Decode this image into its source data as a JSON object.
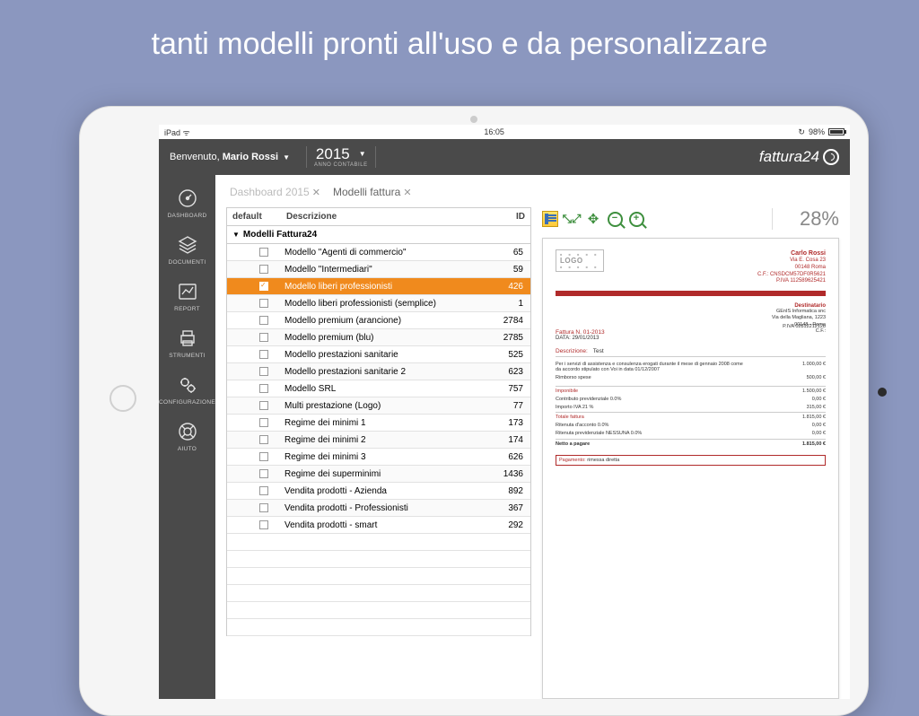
{
  "banner": "tanti modelli pronti all'uso e da personalizzare",
  "status": {
    "device": "iPad",
    "time": "16:05",
    "battery": "98%"
  },
  "header": {
    "welcome_prefix": "Benvenuto, ",
    "user_name": "Mario Rossi",
    "year": "2015",
    "year_sub": "ANNO CONTABILE",
    "brand": "fattura24"
  },
  "sidebar": [
    {
      "key": "dashboard",
      "label": "DASHBOARD"
    },
    {
      "key": "documenti",
      "label": "DOCUMENTI"
    },
    {
      "key": "report",
      "label": "REPORT"
    },
    {
      "key": "strumenti",
      "label": "STRUMENTI"
    },
    {
      "key": "config",
      "label": "CONFIGURAZIONE"
    },
    {
      "key": "aiuto",
      "label": "AIUTO"
    }
  ],
  "crumbs": {
    "dashboard": "Dashboard 2015",
    "modelli": "Modelli fattura"
  },
  "table": {
    "col_default": "default",
    "col_desc": "Descrizione",
    "col_id": "ID",
    "group": "Modelli Fattura24",
    "rows": [
      {
        "desc": "Modello \"Agenti di commercio\"",
        "id": 65,
        "checked": false
      },
      {
        "desc": "Modello \"Intermediari\"",
        "id": 59,
        "checked": false
      },
      {
        "desc": "Modello liberi professionisti",
        "id": 426,
        "checked": true
      },
      {
        "desc": "Modello liberi professionisti (semplice)",
        "id": 1,
        "checked": false
      },
      {
        "desc": "Modello premium (arancione)",
        "id": 2784,
        "checked": false
      },
      {
        "desc": "Modello premium (blu)",
        "id": 2785,
        "checked": false
      },
      {
        "desc": "Modello prestazioni sanitarie",
        "id": 525,
        "checked": false
      },
      {
        "desc": "Modello prestazioni sanitarie 2",
        "id": 623,
        "checked": false
      },
      {
        "desc": "Modello SRL",
        "id": 757,
        "checked": false
      },
      {
        "desc": "Multi prestazione (Logo)",
        "id": 77,
        "checked": false
      },
      {
        "desc": "Regime dei minimi 1",
        "id": 173,
        "checked": false
      },
      {
        "desc": "Regime dei minimi 2",
        "id": 174,
        "checked": false
      },
      {
        "desc": "Regime dei minimi 3",
        "id": 626,
        "checked": false
      },
      {
        "desc": "Regime dei superminimi",
        "id": 1436,
        "checked": false
      },
      {
        "desc": "Vendita prodotti - Azienda",
        "id": 892,
        "checked": false
      },
      {
        "desc": "Vendita prodotti - Professionisti",
        "id": 367,
        "checked": false
      },
      {
        "desc": "Vendita prodotti - smart",
        "id": 292,
        "checked": false
      }
    ]
  },
  "toolbar": {
    "zoom_pct": "28%"
  },
  "preview": {
    "logo": "LOGO",
    "sender": {
      "name": "Carlo Rossi",
      "addr1": "Via E. Cosa 23",
      "addr2": "00148 Roma",
      "cf": "C.F.: CNSDCM57DF0R5621",
      "piva": "P.IVA 112589625421"
    },
    "dest_label": "Destinatario",
    "dest": {
      "name": "GEnIS Informatica snc",
      "addr": "Via della Magliana, 1223",
      "city": "00148 - Roma",
      "cf": "C.F.:",
      "piva": "P.IVA 02812212128"
    },
    "doc_no_label": "Fattura N.",
    "doc_no": "01-2013",
    "date_label": "DATA:",
    "date": "29/01/2013",
    "desc_label": "Descrizione:",
    "desc_val": "Test",
    "lines": [
      {
        "label": "Per i servizi di assistenza e consulenza erogati durante il mese di gennaio 2008 come da accordo stipulato con Voi in data 01/12/2007",
        "value": "1.000,00 €"
      },
      {
        "label": "Rimborso spese",
        "value": "500,00 €"
      }
    ],
    "totals": [
      {
        "label": "Imponibile",
        "value": "1.500,00 €",
        "red": true,
        "br": true
      },
      {
        "label": "Contributo previdenziale  0.0%",
        "value": "0,00 €"
      },
      {
        "label": "Importo IVA 21 %",
        "value": "315,00 €"
      },
      {
        "label": "Totale fattura",
        "value": "1.815,00 €",
        "red": true,
        "br": true
      },
      {
        "label": "Ritenuta d'acconto 0.0%",
        "value": "0,00 €"
      },
      {
        "label": "Ritenuta previdenziale NESSUNA 0.0%",
        "value": "0,00 €"
      },
      {
        "label": "Netto a pagare",
        "value": "1.815,00 €",
        "bold": true,
        "br": true
      }
    ],
    "payment_label": "Pagamento:",
    "payment_value": "rimessa diretta"
  }
}
